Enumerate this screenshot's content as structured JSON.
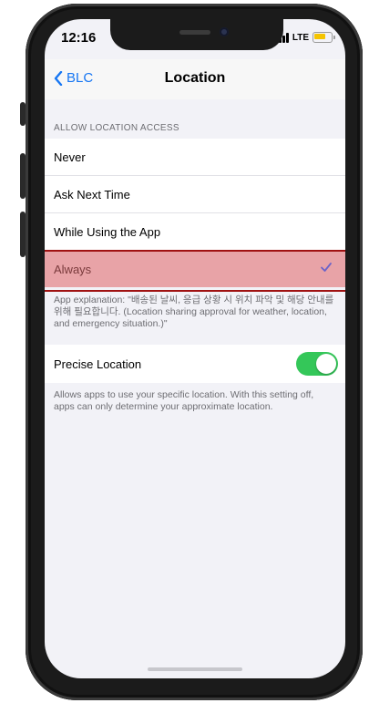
{
  "status_bar": {
    "time": "12:16",
    "network": "LTE",
    "battery_color": "#f5c400",
    "icons": [
      "signal-icon",
      "battery-icon"
    ]
  },
  "navbar": {
    "back_label": "BLC",
    "back_icon": "chevron-left-icon",
    "title": "Location",
    "accent_color": "#1676f3"
  },
  "location_access": {
    "header": "ALLOW LOCATION ACCESS",
    "options": [
      {
        "label": "Never",
        "selected": false
      },
      {
        "label": "Ask Next Time",
        "selected": false
      },
      {
        "label": "While Using the App",
        "selected": false
      },
      {
        "label": "Always",
        "selected": true
      }
    ],
    "selected_icon": "checkmark-icon",
    "explanation": "App explanation: \"배송된 날씨, 응급 상황 시 위치 파악 및 해당 안내를 위해 필요합니다. (Location sharing approval for weather, location, and emergency situation.)\""
  },
  "precise_location": {
    "label": "Precise Location",
    "enabled": true,
    "toggle_color": "#34c759",
    "description": "Allows apps to use your specific location. With this setting off, apps can only determine your approximate location."
  }
}
